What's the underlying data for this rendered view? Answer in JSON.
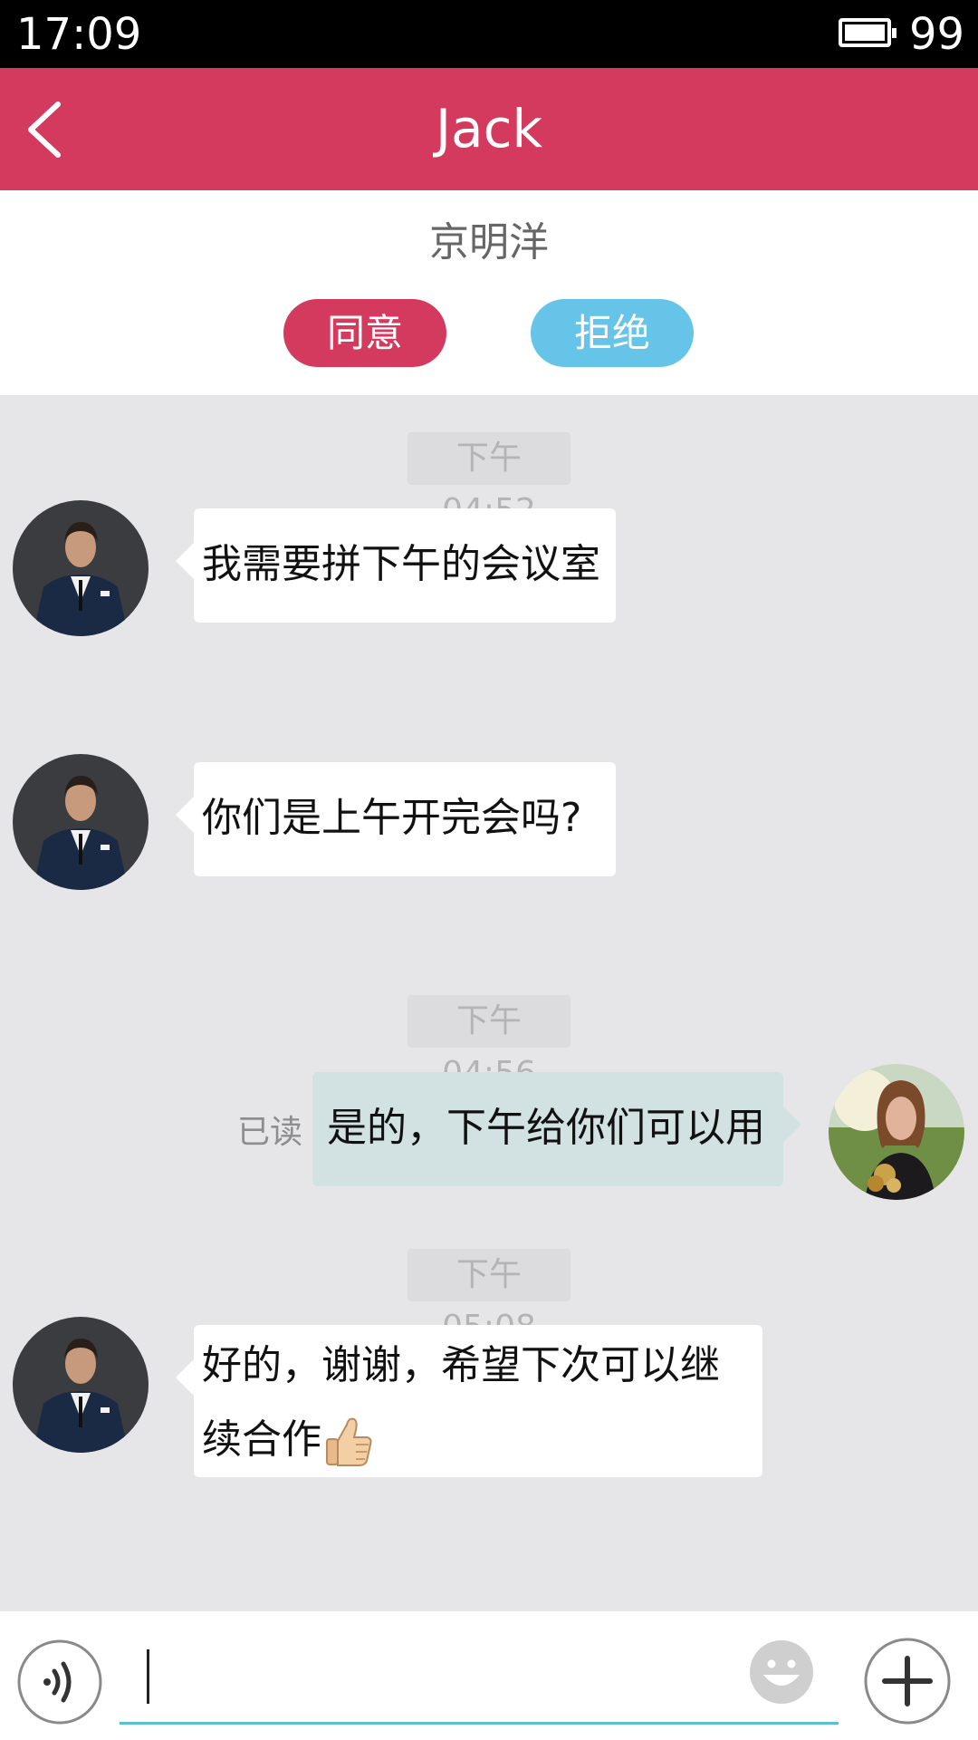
{
  "status_bar": {
    "time": "17:09",
    "battery": "99"
  },
  "header": {
    "title": "Jack"
  },
  "request": {
    "requester": "京明洋",
    "agree_label": "同意",
    "reject_label": "拒绝"
  },
  "timestamps": [
    "下午 04:52",
    "下午 04:56",
    "下午 05:08"
  ],
  "messages": [
    {
      "from": "Jack",
      "lines": [
        "我需要拼下午的会议室"
      ]
    },
    {
      "from": "Jack",
      "lines": [
        "你们是上午开完会吗?"
      ]
    },
    {
      "from": "me",
      "lines": [
        "是的，下午给你们可以用"
      ],
      "status": "已读"
    },
    {
      "from": "Jack",
      "lines": [
        "好的，谢谢，希望下次可以继",
        "续合作"
      ],
      "emoji": "thumbs-up"
    }
  ],
  "input": {
    "value": "",
    "placeholder": ""
  },
  "colors": {
    "accent": "#d43a5e",
    "reject": "#66c4e8",
    "chat_background": "#e6e6e8",
    "outgoing_bubble": "#d2e2e3",
    "input_underline": "#5bbfd6"
  }
}
